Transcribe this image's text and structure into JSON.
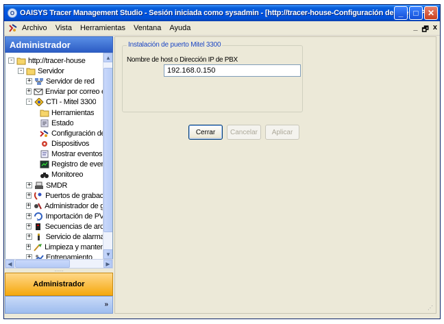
{
  "window": {
    "title": "OAISYS Tracer Management Studio - Sesión iniciada como sysadmin - [http://tracer-house-Configuración de puerto PBX]",
    "app_icon_glyph": "O",
    "minimize": "_",
    "maximize": "□",
    "close": "✕"
  },
  "menu": {
    "items": [
      "Archivo",
      "Vista",
      "Herramientas",
      "Ventana",
      "Ayuda"
    ],
    "doc_minimize": "_",
    "doc_restore": "🗗",
    "doc_close": "x"
  },
  "sidebar": {
    "header": "Administrador",
    "tree": [
      {
        "label": "http://tracer-house",
        "icon": "folder-icon",
        "expander": "-",
        "level": 0
      },
      {
        "label": "Servidor",
        "icon": "folder-icon",
        "expander": "-",
        "level": 1
      },
      {
        "label": "Servidor de red",
        "icon": "network-server-icon",
        "expander": "+",
        "level": 2
      },
      {
        "label": "Enviar por correo elec",
        "icon": "email-icon",
        "expander": "+",
        "level": 2
      },
      {
        "label": "CTI - Mitel 3300",
        "icon": "cti-icon",
        "expander": "-",
        "level": 2
      },
      {
        "label": "Herramientas",
        "icon": "folder-icon",
        "expander": "",
        "level": 3
      },
      {
        "label": "Estado",
        "icon": "status-icon",
        "expander": "",
        "level": 3
      },
      {
        "label": "Configuración de puerto PBX",
        "icon": "pbx-config-icon",
        "expander": "",
        "level": 3
      },
      {
        "label": "Dispositivos",
        "icon": "devices-icon",
        "expander": "",
        "level": 3
      },
      {
        "label": "Mostrar eventos",
        "icon": "events-icon",
        "expander": "",
        "level": 3
      },
      {
        "label": "Registro de eventos",
        "icon": "event-log-icon",
        "expander": "",
        "level": 3
      },
      {
        "label": "Monitoreo",
        "icon": "binoculars-icon",
        "expander": "",
        "level": 3
      },
      {
        "label": "SMDR",
        "icon": "smdr-icon",
        "expander": "+",
        "level": 2
      },
      {
        "label": "Puertos de grabación",
        "icon": "recording-ports-icon",
        "expander": "+",
        "level": 2
      },
      {
        "label": "Administrador de grabación",
        "icon": "recording-admin-icon",
        "expander": "+",
        "level": 2
      },
      {
        "label": "Importación de PVD",
        "icon": "import-icon",
        "expander": "+",
        "level": 2
      },
      {
        "label": "Secuencias de archivo",
        "icon": "sequences-icon",
        "expander": "+",
        "level": 2
      },
      {
        "label": "Servicio de alarmas",
        "icon": "alarm-icon",
        "expander": "+",
        "level": 2
      },
      {
        "label": "Limpieza y mantenimiento",
        "icon": "cleanup-icon",
        "expander": "+",
        "level": 2
      },
      {
        "label": "Entrenamiento",
        "icon": "training-icon",
        "expander": "+",
        "level": 2
      }
    ],
    "active_tab": "Administrador",
    "more_glyph": "»",
    "grip": "........"
  },
  "content": {
    "group_title": "Instalación de puerto Mitel 3300",
    "field_label": "Nombre de host o Dirección IP de PBX",
    "field_value": "192.168.0.150",
    "buttons": {
      "close": "Cerrar",
      "cancel": "Cancelar",
      "apply": "Aplicar"
    }
  },
  "colors": {
    "titlebar": "#0054e3",
    "group_title": "#1a45c4",
    "active_tab": "#f5a80d"
  }
}
